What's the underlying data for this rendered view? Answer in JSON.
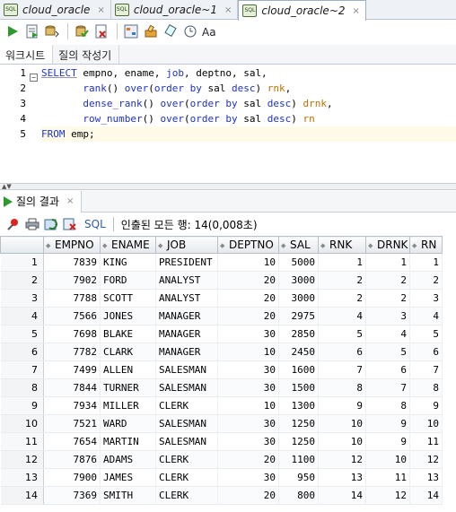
{
  "tabs": [
    {
      "label": "cloud_oracle"
    },
    {
      "label": "cloud_oracle~1"
    },
    {
      "label": "cloud_oracle~2"
    }
  ],
  "toolbar": {
    "icons": [
      "run-statement-icon",
      "run-script-icon",
      "commit-icon",
      "rollback-icon",
      "explain-plan-icon",
      "autotrace-icon",
      "sql-tuning-icon",
      "clear-icon",
      "history-icon",
      "format-icon"
    ]
  },
  "subtabs": {
    "worksheet": "워크시트",
    "query_builder": "질의 작성기"
  },
  "editor": {
    "line_numbers": [
      "1",
      "2",
      "3",
      "4",
      "5"
    ],
    "fold_marker": "−",
    "line1": {
      "kw1": "SELECT",
      "rest1": " empno, ename, ",
      "job": "job",
      "rest2": ", deptno, sal,"
    },
    "line2": {
      "indent": "       ",
      "fn": "rank",
      "p1": "() ",
      "over": "over",
      "p2": "(",
      "ob": "order by",
      "p3": " sal ",
      "desc": "desc",
      "p4": ") ",
      "alias": "rnk",
      "p5": ","
    },
    "line3": {
      "indent": "       ",
      "fn": "dense_rank",
      "p1": "() ",
      "over": "over",
      "p2": "(",
      "ob": "order by",
      "p3": " sal ",
      "desc": "desc",
      "p4": ") ",
      "alias": "drnk",
      "p5": ","
    },
    "line4": {
      "indent": "       ",
      "fn": "row_number",
      "p1": "() ",
      "over": "over",
      "p2": "(",
      "ob": "order by",
      "p3": " sal ",
      "desc": "desc",
      "p4": ") ",
      "alias": "rn",
      "p5": ""
    },
    "line5": {
      "kw": "FROM",
      "rest": " emp;"
    }
  },
  "results": {
    "tab_label": "질의 결과",
    "sql_label": "SQL",
    "status": "인출된 모든 행: 14(0,008초)",
    "columns": [
      "EMPNO",
      "ENAME",
      "JOB",
      "DEPTNO",
      "SAL",
      "RNK",
      "DRNK",
      "RN"
    ],
    "rows": [
      [
        "1",
        "7839",
        "KING",
        "PRESIDENT",
        "10",
        "5000",
        "1",
        "1",
        "1"
      ],
      [
        "2",
        "7902",
        "FORD",
        "ANALYST",
        "20",
        "3000",
        "2",
        "2",
        "2"
      ],
      [
        "3",
        "7788",
        "SCOTT",
        "ANALYST",
        "20",
        "3000",
        "2",
        "2",
        "3"
      ],
      [
        "4",
        "7566",
        "JONES",
        "MANAGER",
        "20",
        "2975",
        "4",
        "3",
        "4"
      ],
      [
        "5",
        "7698",
        "BLAKE",
        "MANAGER",
        "30",
        "2850",
        "5",
        "4",
        "5"
      ],
      [
        "6",
        "7782",
        "CLARK",
        "MANAGER",
        "10",
        "2450",
        "6",
        "5",
        "6"
      ],
      [
        "7",
        "7499",
        "ALLEN",
        "SALESMAN",
        "30",
        "1600",
        "7",
        "6",
        "7"
      ],
      [
        "8",
        "7844",
        "TURNER",
        "SALESMAN",
        "30",
        "1500",
        "8",
        "7",
        "8"
      ],
      [
        "9",
        "7934",
        "MILLER",
        "CLERK",
        "10",
        "1300",
        "9",
        "8",
        "9"
      ],
      [
        "10",
        "7521",
        "WARD",
        "SALESMAN",
        "30",
        "1250",
        "10",
        "9",
        "10"
      ],
      [
        "11",
        "7654",
        "MARTIN",
        "SALESMAN",
        "30",
        "1250",
        "10",
        "9",
        "11"
      ],
      [
        "12",
        "7876",
        "ADAMS",
        "CLERK",
        "20",
        "1100",
        "12",
        "10",
        "12"
      ],
      [
        "13",
        "7900",
        "JAMES",
        "CLERK",
        "30",
        "950",
        "13",
        "11",
        "13"
      ],
      [
        "14",
        "7369",
        "SMITH",
        "CLERK",
        "20",
        "800",
        "14",
        "12",
        "14"
      ]
    ]
  }
}
